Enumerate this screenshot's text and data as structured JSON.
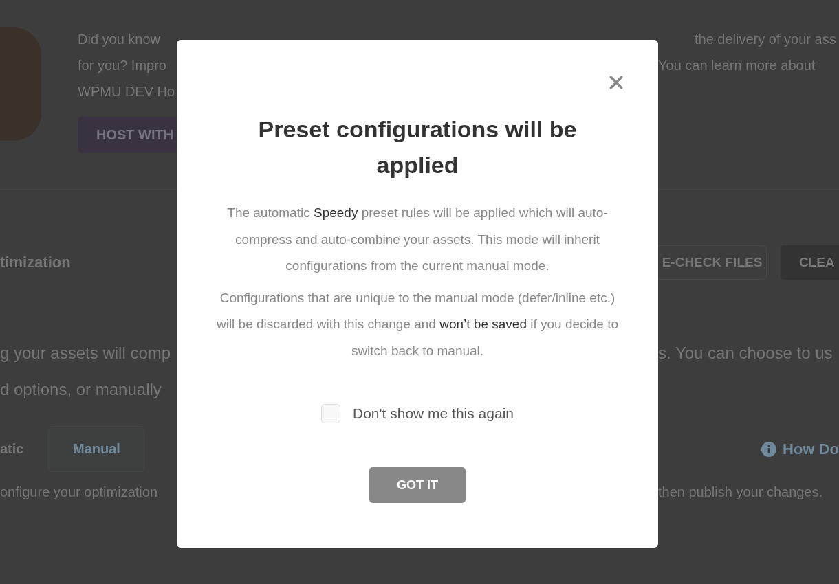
{
  "background": {
    "promo": {
      "lines": [
        {
          "left": "Did you know",
          "right": "the delivery of your ass"
        },
        {
          "left": "for you? Impro",
          "right": "You can learn more about"
        },
        {
          "left": "WPMU DEV Ho"
        }
      ],
      "button": "HOST WITH"
    },
    "section": {
      "title": "timization",
      "buttons": [
        {
          "label": "E-CHECK FILES",
          "kind": "outline"
        },
        {
          "label": "CLEA",
          "kind": "filled"
        }
      ]
    },
    "description": [
      {
        "left": "g your assets will comp",
        "right": "s. You can choose to us"
      },
      {
        "left": "d options, or manually"
      }
    ],
    "tabs": [
      {
        "label": "atic",
        "selected": false
      },
      {
        "label": "Manual",
        "selected": true
      }
    ],
    "help_link": "How Do",
    "note": {
      "left": "onfigure your optimization",
      "right": "then publish your changes."
    }
  },
  "modal": {
    "title": "Preset configurations will be applied",
    "paragraphs": [
      "The automatic **Speedy** preset rules will be applied which will auto-compress and auto-combine your assets. This mode will inherit configurations from the current manual mode.",
      "Configurations that are unique to the manual mode (defer/inline etc.) will be discarded with this change and **won’t be saved** if you decide to switch back to manual."
    ],
    "checkbox": {
      "label": "Don't show me this again",
      "checked": false
    },
    "button": "GOT IT"
  }
}
